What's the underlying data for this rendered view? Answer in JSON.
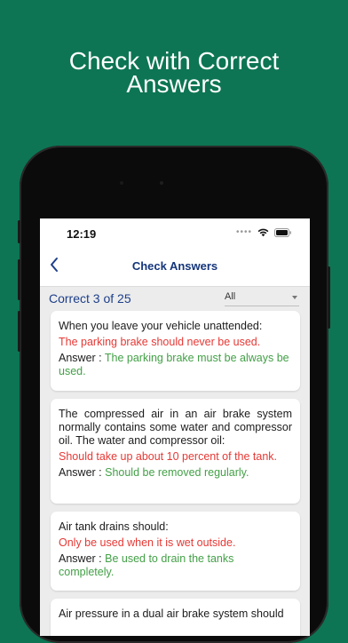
{
  "promo": {
    "headline_line1": "Check with Correct",
    "headline_line2": "Answers"
  },
  "status_bar": {
    "time": "12:19"
  },
  "nav": {
    "title": "Check Answers"
  },
  "summary": {
    "correct_text": "Correct 3 of 25",
    "filter_value": "All"
  },
  "answer_label": "Answer : ",
  "questions": [
    {
      "question": "When you leave your vehicle unattended:",
      "your_answer": "The parking brake should never be used.",
      "correct_answer": "The parking brake must be always be used."
    },
    {
      "question": "The compressed air in an air brake system normally contains some water and compressor oil. The water and compressor oil:",
      "your_answer": "Should take up about 10 percent of the tank.",
      "correct_answer": "Should be removed regularly."
    },
    {
      "question": "Air tank drains should:",
      "your_answer": "Only be used when it is wet outside.",
      "correct_answer": "Be used to drain the tanks completely."
    },
    {
      "question": "Air pressure in a dual air brake system should"
    }
  ],
  "colors": {
    "background": "#0d7553",
    "nav_title": "#14357a",
    "wrong_answer": "#e53935",
    "correct_answer": "#43a047"
  }
}
